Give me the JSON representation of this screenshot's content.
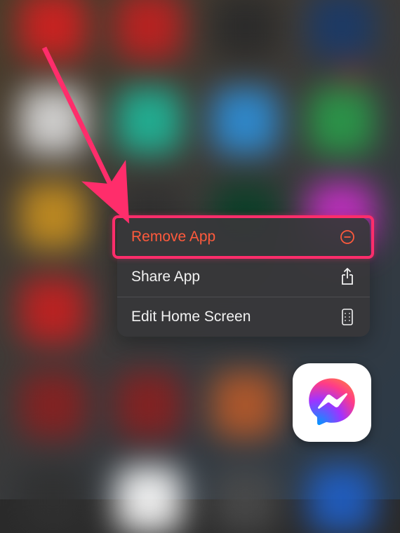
{
  "context_menu": {
    "items": [
      {
        "label": "Remove App",
        "icon": "remove-icon",
        "destructive": true
      },
      {
        "label": "Share App",
        "icon": "share-icon",
        "destructive": false
      },
      {
        "label": "Edit Home Screen",
        "icon": "edit-home-icon",
        "destructive": false
      }
    ]
  },
  "focused_app": {
    "name": "Messenger"
  },
  "annotation": {
    "highlight_color": "#ff2d6b"
  }
}
